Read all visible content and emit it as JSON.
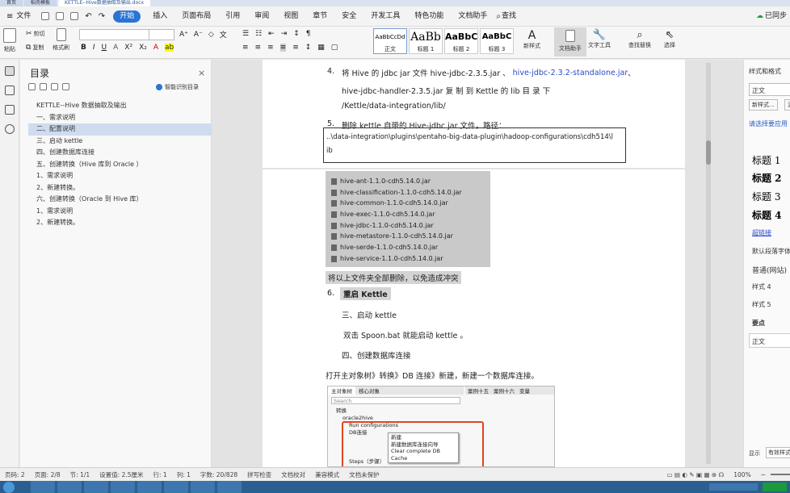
{
  "titlebar": {
    "tabs": [
      "首页",
      "稻壳模板",
      "KETTLE--Hive数据抽取及输出.docx"
    ]
  },
  "menu": {
    "file": "文件",
    "items": [
      "开始",
      "插入",
      "页面布局",
      "引用",
      "审阅",
      "视图",
      "章节",
      "安全",
      "开发工具",
      "特色功能",
      "文档助手"
    ],
    "search": "查找",
    "sync": "已同步"
  },
  "ribbon": {
    "paste": "粘贴",
    "cut": "剪切",
    "copy": "复制",
    "format_painter": "格式刷",
    "styles": [
      {
        "preview": "AaBbCcDd",
        "name": "正文"
      },
      {
        "preview": "AaBb",
        "name": "标题 1"
      },
      {
        "preview": "AaBbC",
        "name": "标题 2"
      },
      {
        "preview": "AaBbC",
        "name": "标题 3"
      }
    ],
    "new_style": "新样式",
    "doc_assistant": "文档助手",
    "text_tools": "文字工具",
    "find_replace": "查找替换",
    "select": "选择"
  },
  "toc": {
    "title": "目录",
    "smart": "智能识别目录",
    "items": [
      "KETTLE--Hive 数据抽取及输出",
      "一、需求说明",
      "二、配置说明",
      "三、启动 kettle",
      "四、创建数据库连接",
      "五、创建转换（Hive 库到 Oracle ）",
      "1、需求说明",
      "2、新建转换。",
      "六、创建转换（Oracle 到 Hive 库）",
      "1、需求说明",
      "2、新建转换。"
    ],
    "selected_index": 2
  },
  "doc": {
    "step4_num": "4.",
    "step4_line1a": "将 Hive 的 jdbc jar 文件 hive-jdbc-2.3.5.jar 、",
    "step4_line1b": "hive-jdbc-2.3.2-standalone.jar",
    "step4_line1c": "、",
    "step4_line2": "hive-jdbc-handler-2.3.5.jar   复  制  到   Kettle   的   lib   目  录  下",
    "step4_line3": "/Kettle/data-integration/lib/",
    "step5_num": "5.",
    "step5_text": "删除 kettle 自带的 Hive-jdbc jar 文件，路径：",
    "path_line1": "..\\data-integration\\plugins\\pentaho-big-data-plugin\\hadoop-configurations\\cdh514\\l",
    "path_line2": "ib",
    "files": [
      "hive-ant-1.1.0-cdh5.14.0.jar",
      "hive-classification-1.1.0-cdh5.14.0.jar",
      "hive-common-1.1.0-cdh5.14.0.jar",
      "hive-exec-1.1.0-cdh5.14.0.jar",
      "hive-jdbc-1.1.0-cdh5.14.0.jar",
      "hive-metastore-1.1.0-cdh5.14.0.jar",
      "hive-serde-1.1.0-cdh5.14.0.jar",
      "hive-service-1.1.0-cdh5.14.0.jar"
    ],
    "delete_note": "将以上文件夹全部删除，以免造成冲突",
    "step6_num": "6.",
    "step6_text": "重启 Kettle",
    "h3": "三、启动 kettle",
    "start_text": "双击  Spoon.bat  就能启动  kettle  。",
    "h4": "四、创建数据库连接",
    "open_text": "打开主对象树》转换》DB 连接》新建，新建一个数据库连接。"
  },
  "screenshot": {
    "tab1": "主对象树",
    "tab2": "核心对象",
    "tab3": "案例十五",
    "tab4": "案例十六",
    "tab5": "变量",
    "search": "Search",
    "tree": [
      "转换",
      "oracle2hive",
      "Run configurations",
      "DB连接",
      "Steps（步骤）"
    ],
    "menu": [
      "新建",
      "新建数据库连接向导",
      "Clear complete DB Cache"
    ]
  },
  "right": {
    "title": "样式和格式",
    "current": "正文",
    "new_style": "新样式...",
    "clear": "清",
    "hint": "请选择要应用",
    "h1": "标题 1",
    "h2": "标题 2",
    "h3": "标题 3",
    "h4": "标题 4",
    "hyperlink": "超链接",
    "default_font": "默认段落字体",
    "normal_web": "普通(网站)",
    "style4": "样式 4",
    "style5": "样式 5",
    "key": "要点",
    "body": "正文",
    "show": "显示",
    "valid": "有效样式"
  },
  "status": {
    "items": [
      "页码: 2",
      "页面: 2/8",
      "节: 1/1",
      "设置值: 2.5厘米",
      "行: 1",
      "列: 1",
      "字数: 20/828",
      "拼写检查",
      "文档校对",
      "兼容模式",
      "文档未保护"
    ],
    "zoom": "100%"
  }
}
